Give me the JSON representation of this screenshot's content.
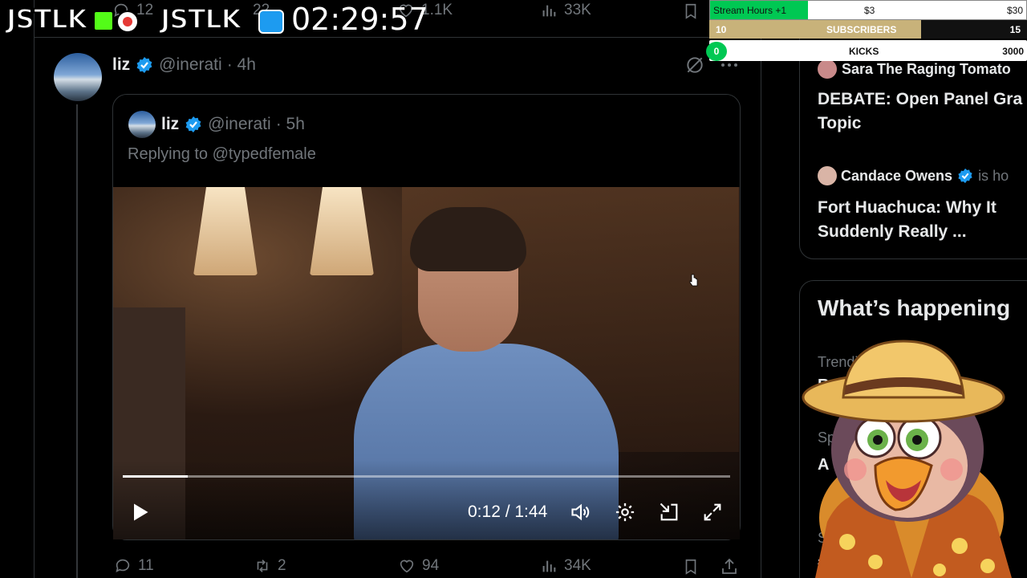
{
  "overlay": {
    "logo1": "JSTLK",
    "logo2": "JSTLK",
    "clock": "02:29:57",
    "stream_hours_label": "Stream Hours +1",
    "stream_hours_price": "$3",
    "stream_hours_price2": "$30",
    "subs_count": "10",
    "subs_label": "SUBSCRIBERS",
    "subs_goal": "15",
    "kicks_count": "0",
    "kicks_label": "KICKS",
    "kicks_goal": "3000",
    "subs_progress": 0.667
  },
  "prev_tweet": {
    "replies": "12",
    "retweets": "22",
    "likes": "1.1K",
    "views": "33K"
  },
  "tweet": {
    "name": "liz",
    "handle": "@inerati",
    "time": "· 4h",
    "quote": {
      "name": "liz",
      "handle": "@inerati",
      "time": "· 5h",
      "replying_to": "Replying to @typedfemale"
    },
    "video": {
      "time_display": "0:12 / 1:44",
      "progress": 0.107
    },
    "actions": {
      "replies": "11",
      "retweets": "2",
      "likes": "94",
      "views": "34K"
    }
  },
  "sidebar": {
    "live1_name": "Sara The Raging Tomato",
    "live1_title": "DEBATE: Open Panel Gra Topic",
    "live2_name": "Candace Owens",
    "live2_suffix": "is ho",
    "live2_title": "Fort Huachuca: Why It Suddenly Really ...",
    "whats_happening": "What’s happening",
    "trend_label": "Trendi",
    "trend_letters": "Re",
    "sp_label": "Sp",
    "a_letter": "A",
    "s_letter": "S",
    "hash": "#"
  },
  "colors": {
    "accent_blue": "#1d9bf0",
    "stream_green": "#00c853",
    "subs_gold": "#c8b27a"
  }
}
